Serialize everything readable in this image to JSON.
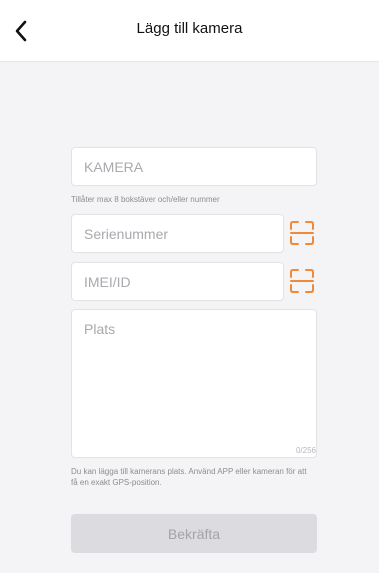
{
  "header": {
    "title": "Lägg till kamera",
    "back_icon": "chevron-left-icon"
  },
  "form": {
    "camera": {
      "placeholder": "KAMERA",
      "value": "",
      "hint": "Tillåter max 8 bokstäver och/eller nummer"
    },
    "serial": {
      "placeholder": "Serienummer",
      "value": "",
      "scan_icon": "scan-icon"
    },
    "imei": {
      "placeholder": "IMEI/ID",
      "value": "",
      "scan_icon": "scan-icon"
    },
    "location": {
      "placeholder": "Plats",
      "value": "",
      "counter": "0/256",
      "hint": "Du kan lägga till kamerans plats. Använd APP eller kameran för att få en exakt GPS-position."
    },
    "confirm_label": "Bekräfta"
  },
  "colors": {
    "accent": "#f08a3a",
    "background": "#f4f4f6",
    "button_disabled_bg": "#dcdce0",
    "button_disabled_text": "#a3a3a8"
  }
}
